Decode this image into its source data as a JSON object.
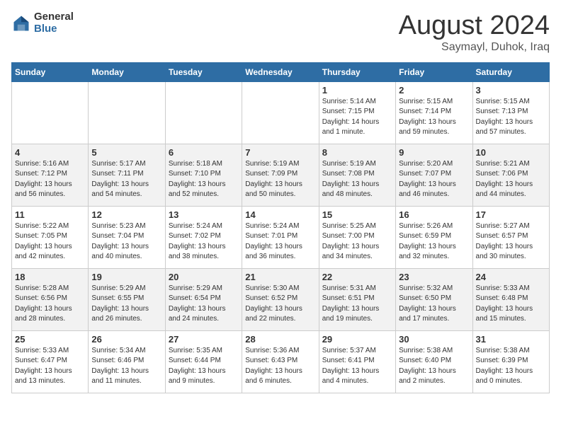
{
  "logo": {
    "general": "General",
    "blue": "Blue"
  },
  "title": "August 2024",
  "subtitle": "Saymayl, Duhok, Iraq",
  "headers": [
    "Sunday",
    "Monday",
    "Tuesday",
    "Wednesday",
    "Thursday",
    "Friday",
    "Saturday"
  ],
  "weeks": [
    [
      {
        "day": "",
        "info": ""
      },
      {
        "day": "",
        "info": ""
      },
      {
        "day": "",
        "info": ""
      },
      {
        "day": "",
        "info": ""
      },
      {
        "day": "1",
        "info": "Sunrise: 5:14 AM\nSunset: 7:15 PM\nDaylight: 14 hours\nand 1 minute."
      },
      {
        "day": "2",
        "info": "Sunrise: 5:15 AM\nSunset: 7:14 PM\nDaylight: 13 hours\nand 59 minutes."
      },
      {
        "day": "3",
        "info": "Sunrise: 5:15 AM\nSunset: 7:13 PM\nDaylight: 13 hours\nand 57 minutes."
      }
    ],
    [
      {
        "day": "4",
        "info": "Sunrise: 5:16 AM\nSunset: 7:12 PM\nDaylight: 13 hours\nand 56 minutes."
      },
      {
        "day": "5",
        "info": "Sunrise: 5:17 AM\nSunset: 7:11 PM\nDaylight: 13 hours\nand 54 minutes."
      },
      {
        "day": "6",
        "info": "Sunrise: 5:18 AM\nSunset: 7:10 PM\nDaylight: 13 hours\nand 52 minutes."
      },
      {
        "day": "7",
        "info": "Sunrise: 5:19 AM\nSunset: 7:09 PM\nDaylight: 13 hours\nand 50 minutes."
      },
      {
        "day": "8",
        "info": "Sunrise: 5:19 AM\nSunset: 7:08 PM\nDaylight: 13 hours\nand 48 minutes."
      },
      {
        "day": "9",
        "info": "Sunrise: 5:20 AM\nSunset: 7:07 PM\nDaylight: 13 hours\nand 46 minutes."
      },
      {
        "day": "10",
        "info": "Sunrise: 5:21 AM\nSunset: 7:06 PM\nDaylight: 13 hours\nand 44 minutes."
      }
    ],
    [
      {
        "day": "11",
        "info": "Sunrise: 5:22 AM\nSunset: 7:05 PM\nDaylight: 13 hours\nand 42 minutes."
      },
      {
        "day": "12",
        "info": "Sunrise: 5:23 AM\nSunset: 7:04 PM\nDaylight: 13 hours\nand 40 minutes."
      },
      {
        "day": "13",
        "info": "Sunrise: 5:24 AM\nSunset: 7:02 PM\nDaylight: 13 hours\nand 38 minutes."
      },
      {
        "day": "14",
        "info": "Sunrise: 5:24 AM\nSunset: 7:01 PM\nDaylight: 13 hours\nand 36 minutes."
      },
      {
        "day": "15",
        "info": "Sunrise: 5:25 AM\nSunset: 7:00 PM\nDaylight: 13 hours\nand 34 minutes."
      },
      {
        "day": "16",
        "info": "Sunrise: 5:26 AM\nSunset: 6:59 PM\nDaylight: 13 hours\nand 32 minutes."
      },
      {
        "day": "17",
        "info": "Sunrise: 5:27 AM\nSunset: 6:57 PM\nDaylight: 13 hours\nand 30 minutes."
      }
    ],
    [
      {
        "day": "18",
        "info": "Sunrise: 5:28 AM\nSunset: 6:56 PM\nDaylight: 13 hours\nand 28 minutes."
      },
      {
        "day": "19",
        "info": "Sunrise: 5:29 AM\nSunset: 6:55 PM\nDaylight: 13 hours\nand 26 minutes."
      },
      {
        "day": "20",
        "info": "Sunrise: 5:29 AM\nSunset: 6:54 PM\nDaylight: 13 hours\nand 24 minutes."
      },
      {
        "day": "21",
        "info": "Sunrise: 5:30 AM\nSunset: 6:52 PM\nDaylight: 13 hours\nand 22 minutes."
      },
      {
        "day": "22",
        "info": "Sunrise: 5:31 AM\nSunset: 6:51 PM\nDaylight: 13 hours\nand 19 minutes."
      },
      {
        "day": "23",
        "info": "Sunrise: 5:32 AM\nSunset: 6:50 PM\nDaylight: 13 hours\nand 17 minutes."
      },
      {
        "day": "24",
        "info": "Sunrise: 5:33 AM\nSunset: 6:48 PM\nDaylight: 13 hours\nand 15 minutes."
      }
    ],
    [
      {
        "day": "25",
        "info": "Sunrise: 5:33 AM\nSunset: 6:47 PM\nDaylight: 13 hours\nand 13 minutes."
      },
      {
        "day": "26",
        "info": "Sunrise: 5:34 AM\nSunset: 6:46 PM\nDaylight: 13 hours\nand 11 minutes."
      },
      {
        "day": "27",
        "info": "Sunrise: 5:35 AM\nSunset: 6:44 PM\nDaylight: 13 hours\nand 9 minutes."
      },
      {
        "day": "28",
        "info": "Sunrise: 5:36 AM\nSunset: 6:43 PM\nDaylight: 13 hours\nand 6 minutes."
      },
      {
        "day": "29",
        "info": "Sunrise: 5:37 AM\nSunset: 6:41 PM\nDaylight: 13 hours\nand 4 minutes."
      },
      {
        "day": "30",
        "info": "Sunrise: 5:38 AM\nSunset: 6:40 PM\nDaylight: 13 hours\nand 2 minutes."
      },
      {
        "day": "31",
        "info": "Sunrise: 5:38 AM\nSunset: 6:39 PM\nDaylight: 13 hours\nand 0 minutes."
      }
    ]
  ]
}
